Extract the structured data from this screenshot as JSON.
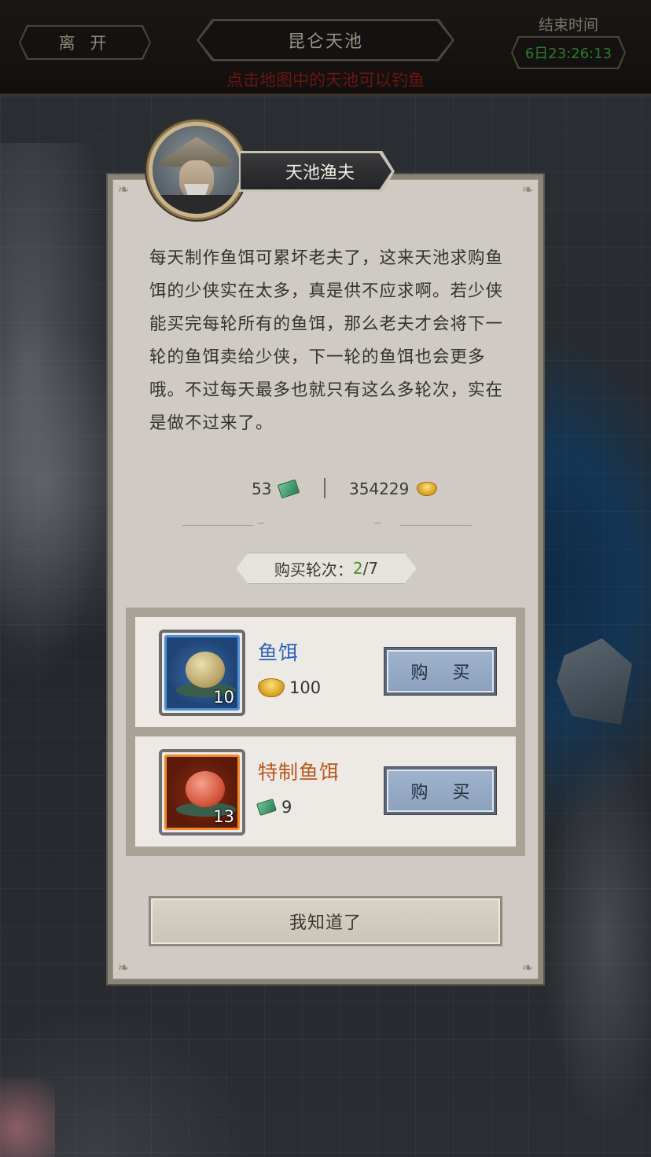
{
  "header": {
    "leave_label": "离 开",
    "title": "昆仑天池",
    "end_time_label": "结束时间",
    "countdown": "6日23:26:13",
    "hint": "点击地图中的天池可以钓鱼"
  },
  "dialog": {
    "npc_name": "天池渔夫",
    "message": "每天制作鱼饵可累坏老夫了，这来天池求购鱼饵的少侠实在太多，真是供不应求啊。若少侠能买完每轮所有的鱼饵，那么老夫才会将下一轮的鱼饵卖给少侠，下一轮的鱼饵也会更多哦。不过每天最多也就只有这么多轮次，实在是做不过来了。",
    "currency": {
      "jade_amount": "53",
      "jade_icon": "jade-icon",
      "gold_amount": "354229",
      "gold_icon": "gold-ingot-icon"
    },
    "rounds": {
      "label": "购买轮次：",
      "current": "2",
      "total": "/7"
    },
    "items": [
      {
        "name": "鱼饵",
        "quantity": "10",
        "price": "100",
        "price_icon": "gold-ingot-icon",
        "buy_label": "购 买",
        "name_color": "#2c62b8",
        "frame_color": "#4f8fd8"
      },
      {
        "name": "特制鱼饵",
        "quantity": "13",
        "price": "9",
        "price_icon": "jade-icon",
        "buy_label": "购 买",
        "name_color": "#b8571a",
        "frame_color": "#f08a28"
      }
    ],
    "confirm_label": "我知道了"
  }
}
